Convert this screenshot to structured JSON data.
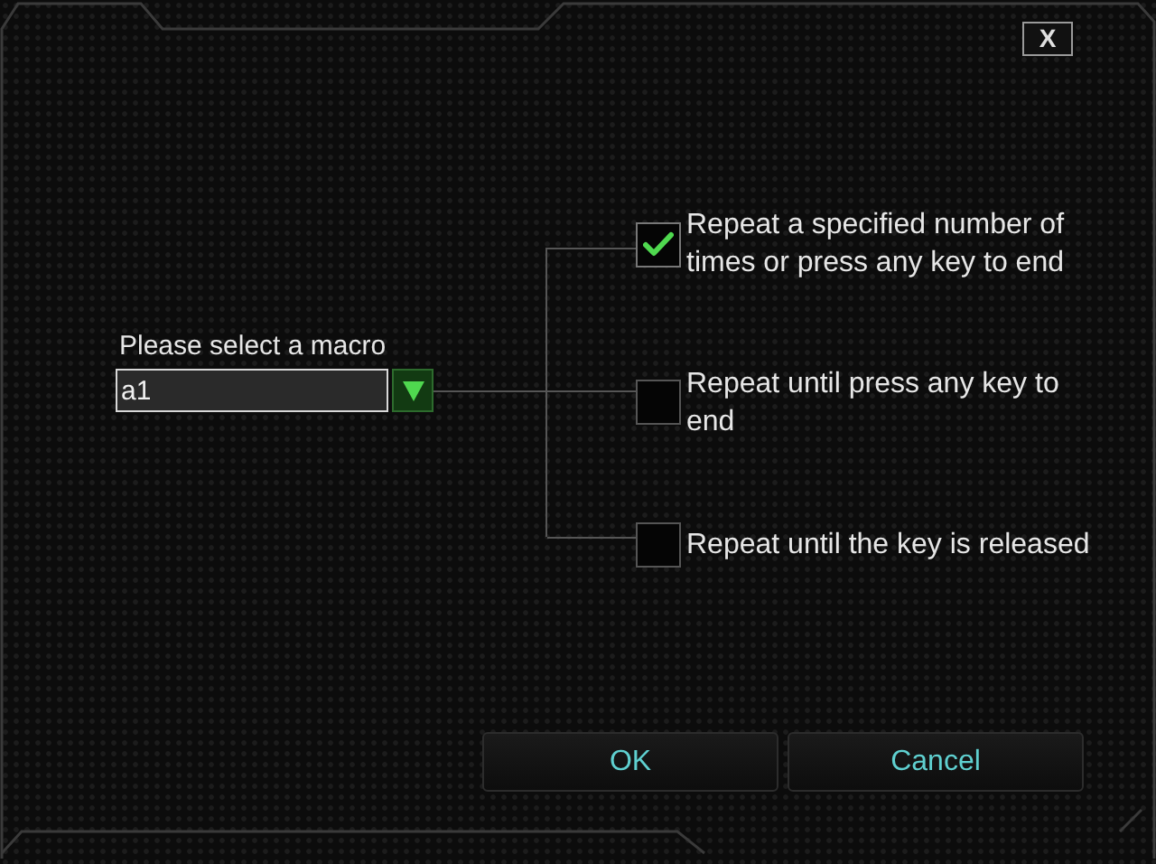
{
  "window": {
    "close_label": "X"
  },
  "macro_select": {
    "label": "Please select a macro",
    "value": "a1"
  },
  "options": [
    {
      "label": "Repeat a specified number of times or press any key to end",
      "checked": true
    },
    {
      "label": "Repeat until press any key to end",
      "checked": false
    },
    {
      "label": "Repeat until the key is released",
      "checked": false
    }
  ],
  "buttons": [
    "OK",
    "Cancel"
  ]
}
